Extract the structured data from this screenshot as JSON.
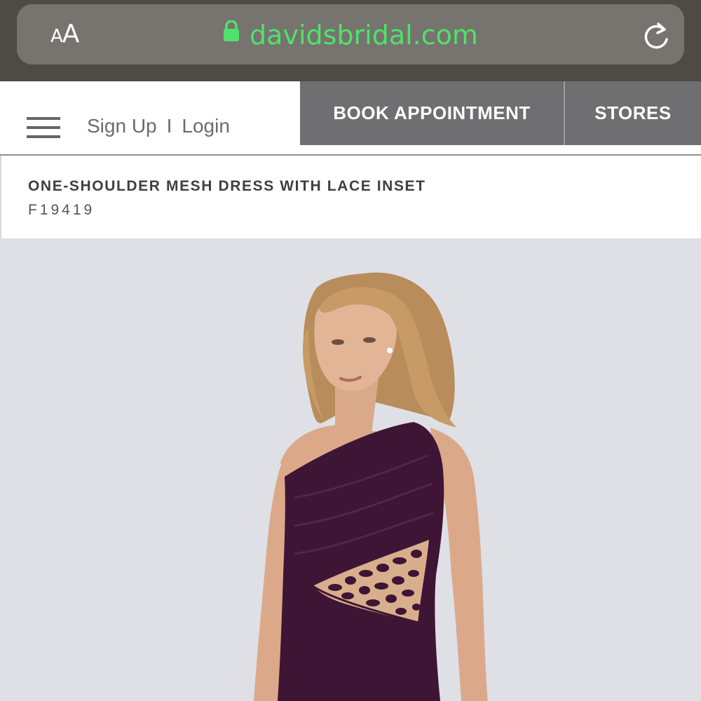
{
  "browser": {
    "text_size_small": "A",
    "text_size_large": "A",
    "url": "davidsbridal.com",
    "url_color": "#4ee26b"
  },
  "header": {
    "sign_up": "Sign Up",
    "separator": "I",
    "login": "Login",
    "book_appointment": "BOOK APPOINTMENT",
    "stores": "STORES"
  },
  "product": {
    "title": "ONE-SHOULDER MESH DRESS WITH LACE INSET",
    "sku": "F19419",
    "dress_color": "#3e1535"
  },
  "icons": {
    "lock": "lock-icon",
    "reload": "reload-icon",
    "menu": "hamburger-menu-icon"
  }
}
